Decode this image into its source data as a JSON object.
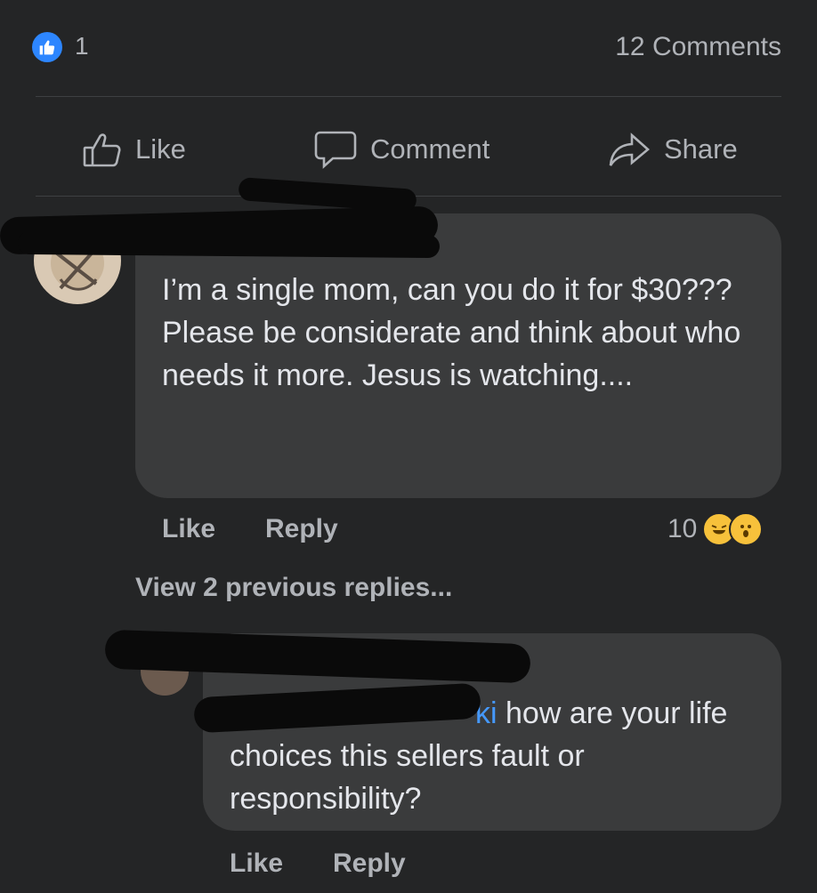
{
  "post_stats": {
    "reaction_count": "1",
    "comments_count": "12 Comments"
  },
  "actions": {
    "like": "Like",
    "comment": "Comment",
    "share": "Share"
  },
  "comment1": {
    "author": "",
    "text": "I’m a single mom, can you do it for $30???\nPlease be considerate and think about who needs it more. Jesus is watching....",
    "like_label": "Like",
    "reply_label": "Reply",
    "reaction_count": "10"
  },
  "view_previous": "View 2 previous replies...",
  "comment2": {
    "mention_visible": "ki",
    "text": " how are your life choices this sellers fault or responsibility?",
    "like_label": "Like",
    "reply_label": "Reply"
  },
  "colors": {
    "background": "#242526",
    "bubble": "#3a3b3c",
    "accent": "#2d86ff"
  },
  "icons": [
    "thumbs-up-icon",
    "comment-bubble-icon",
    "share-arrow-icon",
    "laugh-emoji-icon",
    "wow-emoji-icon"
  ]
}
